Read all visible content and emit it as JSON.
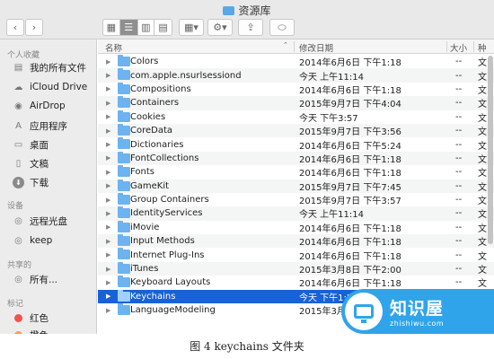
{
  "window": {
    "title": "资源库"
  },
  "toolbar": {
    "back": "‹",
    "forward": "›",
    "view_icon": "▦",
    "list_icon": "☰",
    "column_icon": "▥",
    "cover_icon": "▤",
    "arrange_icon": "▦▾",
    "action_icon": "⚙▾",
    "share_icon": "⇪",
    "tag_icon": "⬭"
  },
  "sidebar": {
    "sections": [
      {
        "heading": "个人收藏"
      },
      {
        "heading": "设备"
      },
      {
        "heading": "共享的"
      },
      {
        "heading": "标记"
      }
    ],
    "items": [
      {
        "label": "我的所有文件",
        "icon": "▤"
      },
      {
        "label": "iCloud Drive",
        "icon": "☁"
      },
      {
        "label": "AirDrop",
        "icon": "◉"
      },
      {
        "label": "应用程序",
        "icon": "A"
      },
      {
        "label": "桌面",
        "icon": "▭"
      },
      {
        "label": "文稿",
        "icon": "▯"
      },
      {
        "label": "下载",
        "icon": "⬇"
      },
      {
        "label": "远程光盘",
        "icon": "◎"
      },
      {
        "label": "keep",
        "icon": "◎"
      },
      {
        "label": "所有...",
        "icon": "◎"
      },
      {
        "label": "红色",
        "icon": ""
      },
      {
        "label": "橙色",
        "icon": ""
      }
    ]
  },
  "list": {
    "headers": {
      "name": "名称",
      "date": "修改日期",
      "size": "大小",
      "kind": "种"
    },
    "rows": [
      {
        "name": "Colors",
        "date": "2014年6月6日 下午1:18",
        "size": "--",
        "kind": "文"
      },
      {
        "name": "com.apple.nsurlsessiond",
        "date": "今天 上午11:14",
        "size": "--",
        "kind": "文"
      },
      {
        "name": "Compositions",
        "date": "2014年6月6日 下午1:18",
        "size": "--",
        "kind": "文"
      },
      {
        "name": "Containers",
        "date": "2015年9月7日 下午4:04",
        "size": "--",
        "kind": "文"
      },
      {
        "name": "Cookies",
        "date": "今天 下午3:57",
        "size": "--",
        "kind": "文"
      },
      {
        "name": "CoreData",
        "date": "2015年9月7日 下午3:56",
        "size": "--",
        "kind": "文"
      },
      {
        "name": "Dictionaries",
        "date": "2014年6月6日 下午5:24",
        "size": "--",
        "kind": "文"
      },
      {
        "name": "FontCollections",
        "date": "2014年6月6日 下午1:18",
        "size": "--",
        "kind": "文"
      },
      {
        "name": "Fonts",
        "date": "2014年6月6日 下午1:18",
        "size": "--",
        "kind": "文"
      },
      {
        "name": "GameKit",
        "date": "2015年9月7日 下午7:45",
        "size": "--",
        "kind": "文"
      },
      {
        "name": "Group Containers",
        "date": "2015年9月7日 下午3:57",
        "size": "--",
        "kind": "文"
      },
      {
        "name": "IdentityServices",
        "date": "今天 上午11:14",
        "size": "--",
        "kind": "文"
      },
      {
        "name": "iMovie",
        "date": "2014年6月6日 下午1:18",
        "size": "--",
        "kind": "文"
      },
      {
        "name": "Input Methods",
        "date": "2014年6月6日 下午1:18",
        "size": "--",
        "kind": "文"
      },
      {
        "name": "Internet Plug-Ins",
        "date": "2014年6月6日 下午1:18",
        "size": "--",
        "kind": "文"
      },
      {
        "name": "iTunes",
        "date": "2015年3月8日 下午2:00",
        "size": "--",
        "kind": "文"
      },
      {
        "name": "Keyboard Layouts",
        "date": "2014年6月6日 下午1:18",
        "size": "--",
        "kind": "文"
      },
      {
        "name": "Keychains",
        "date": "今天 下午1:21",
        "size": "--",
        "kind": "文"
      },
      {
        "name": "LanguageModeling",
        "date": "2015年3月8日",
        "size": "",
        "kind": ""
      }
    ],
    "selected_index": 17
  },
  "watermark": {
    "main": "知识屋",
    "sub": "zhishiwu.com"
  },
  "caption": "图 4  keychains 文件夹"
}
